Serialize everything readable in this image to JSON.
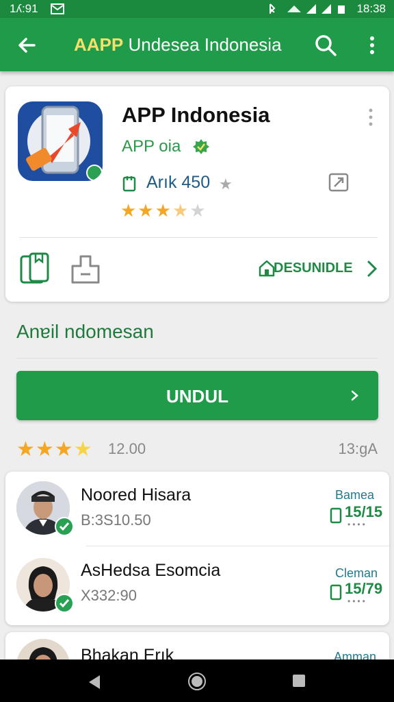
{
  "status_bar": {
    "time_left": "1ʎ:91",
    "time_right": "18:38"
  },
  "app_bar": {
    "title_prefix": "AAPP",
    "title_rest": " Undesea Indonesia",
    "accent_color": "#f4e06a",
    "bar_color": "#1f9b4a"
  },
  "app": {
    "name": "APP Indonesia",
    "developer": "APP oia",
    "rank_label": "Arık 450",
    "rating_stars": 3.5,
    "download_label": "DESUNIDLE"
  },
  "section": {
    "title": "Anɐil ndomesan",
    "install_button": "UNDUL",
    "rating_stars": 3.5,
    "review_count": "12.00",
    "size": "13:gA"
  },
  "reviewers": [
    {
      "name": "Noored Hisara",
      "sub": "B:3S10.50",
      "label": "Bamea",
      "value": "15/15"
    },
    {
      "name": "AsHedsa Esomcia",
      "sub": "X332:90",
      "label": "Cleman",
      "value": "15/79"
    },
    {
      "name": "Bhakan Erık",
      "sub": "",
      "label": "Amman",
      "value": ""
    }
  ],
  "icons": {
    "back": "arrow-left-icon",
    "search": "search-icon",
    "more": "more-vert-icon",
    "verified": "verified-badge-icon",
    "rank": "device-icon",
    "external": "external-link-icon",
    "bookmark": "bookmark-icon",
    "share": "share-icon",
    "home": "home-icon",
    "chevron": "chevron-right-icon"
  }
}
